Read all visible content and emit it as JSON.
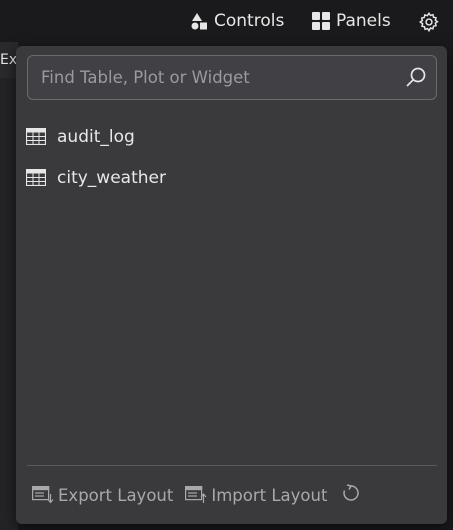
{
  "topbar": {
    "controls_label": "Controls",
    "panels_label": "Panels",
    "settings_icon": "gear-icon"
  },
  "background": {
    "tab_label_partial": "Exp"
  },
  "panels_menu": {
    "search": {
      "placeholder": "Find Table, Plot or Widget",
      "value": ""
    },
    "items": [
      {
        "label": "audit_log",
        "icon": "table-icon"
      },
      {
        "label": "city_weather",
        "icon": "table-icon"
      }
    ],
    "footer": {
      "export_label": "Export Layout",
      "import_label": "Import Layout",
      "reset_icon": "reset-icon"
    }
  },
  "colors": {
    "popup_bg": "#3a393c",
    "app_bg": "#1a1a1c",
    "text_primary": "#e6e6e6",
    "text_muted": "#a9a8ac"
  }
}
